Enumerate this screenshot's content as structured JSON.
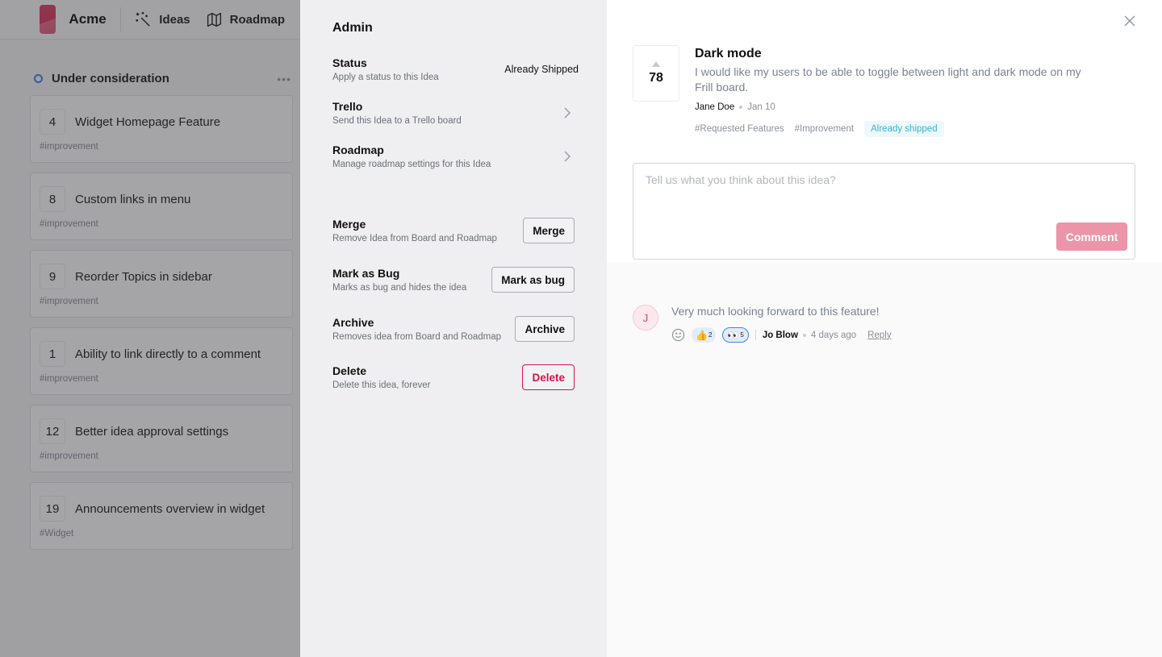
{
  "board": {
    "brand": "Acme",
    "nav": [
      {
        "label": "Ideas",
        "icon": "magic-wand-icon"
      },
      {
        "label": "Roadmap",
        "icon": "map-icon"
      }
    ],
    "column": {
      "title": "Under consideration",
      "more_icon": "ellipsis-icon",
      "cards": [
        {
          "votes": "4",
          "title": "Widget Homepage Feature",
          "tag": "#improvement"
        },
        {
          "votes": "8",
          "title": "Custom links in menu",
          "tag": "#improvement"
        },
        {
          "votes": "9",
          "title": "Reorder Topics in sidebar",
          "tag": "#improvement"
        },
        {
          "votes": "1",
          "title": "Ability to link directly to a comment",
          "tag": "#improvement"
        },
        {
          "votes": "12",
          "title": "Better idea approval settings",
          "tag": "#improvement"
        },
        {
          "votes": "19",
          "title": "Announcements overview in widget",
          "tag": "#Widget"
        }
      ]
    }
  },
  "admin": {
    "title": "Admin",
    "status": {
      "label": "Status",
      "description": "Apply a status to this Idea",
      "value": "Already Shipped"
    },
    "trello": {
      "label": "Trello",
      "description": "Send this Idea to a Trello board"
    },
    "roadmap": {
      "label": "Roadmap",
      "description": "Manage roadmap settings for this Idea"
    },
    "merge": {
      "label": "Merge",
      "description": "Remove Idea from Board and Roadmap",
      "button": "Merge"
    },
    "bug": {
      "label": "Mark as Bug",
      "description": "Marks as bug and hides the idea",
      "button": "Mark as bug"
    },
    "archive": {
      "label": "Archive",
      "description": "Removes idea from Board and Roadmap",
      "button": "Archive"
    },
    "delete": {
      "label": "Delete",
      "description": "Delete this idea, forever",
      "button": "Delete"
    }
  },
  "idea": {
    "votes": "78",
    "title": "Dark mode",
    "description": "I would like my users to be able to toggle between light and dark mode on my Frill board.",
    "author": "Jane Doe",
    "date": "Jan 10",
    "tags": [
      "#Requested Features",
      "#Improvement"
    ],
    "status": "Already shipped",
    "status_color": "#37b3cf",
    "composer": {
      "placeholder": "Tell us what you think about this idea?",
      "button": "Comment"
    },
    "accent": "#ec95a8"
  },
  "comments": [
    {
      "avatar_initial": "J",
      "text": "Very much looking forward to this feature!",
      "reactions": [
        {
          "emoji": "👍",
          "count": "2"
        },
        {
          "emoji": "👀",
          "count": "5"
        }
      ],
      "author": "Jo Blow",
      "time": "4 days ago",
      "reply_label": "Reply"
    }
  ]
}
